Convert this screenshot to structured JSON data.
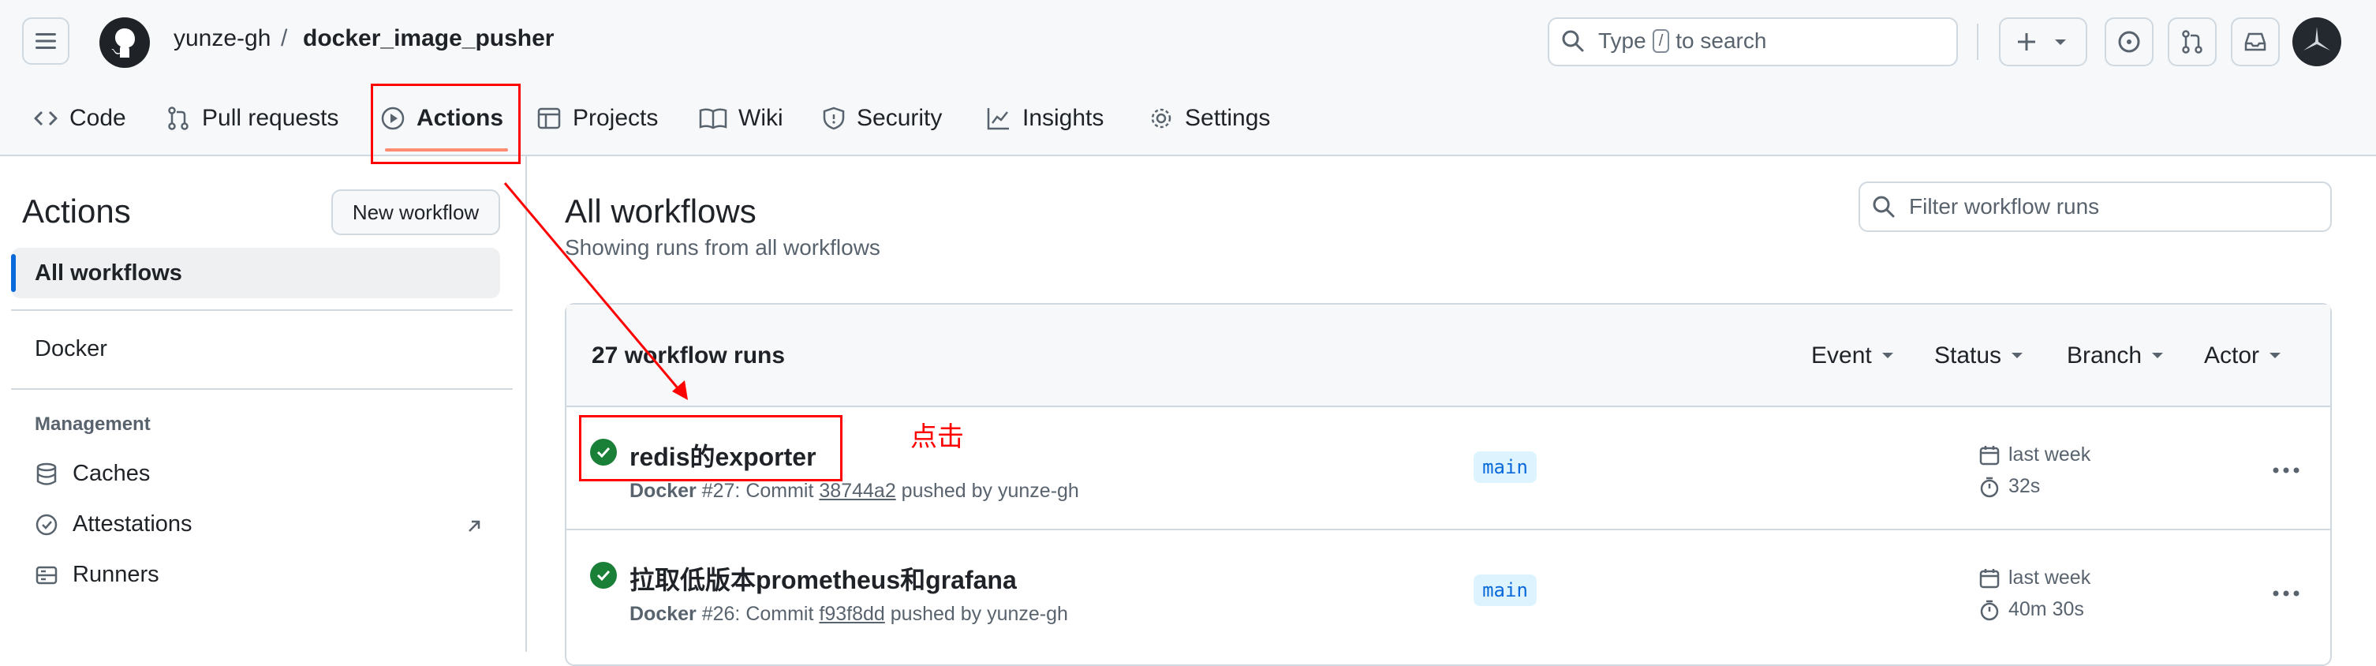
{
  "header": {
    "owner": "yunze-gh",
    "separator": "/",
    "repo": "docker_image_pusher",
    "search_label_pre": "Type",
    "search_key": "/",
    "search_label_post": "to search"
  },
  "tabs": [
    {
      "label": "Code"
    },
    {
      "label": "Pull requests"
    },
    {
      "label": "Actions"
    },
    {
      "label": "Projects"
    },
    {
      "label": "Wiki"
    },
    {
      "label": "Security"
    },
    {
      "label": "Insights"
    },
    {
      "label": "Settings"
    }
  ],
  "sidebar": {
    "title": "Actions",
    "new_workflow": "New workflow",
    "all_workflows": "All workflows",
    "docker": "Docker",
    "management_heading": "Management",
    "caches": "Caches",
    "attestations": "Attestations",
    "runners": "Runners"
  },
  "main": {
    "title": "All workflows",
    "subtitle": "Showing runs from all workflows",
    "filter_placeholder": "Filter workflow runs",
    "runs_count": "27 workflow runs",
    "filters": [
      "Event",
      "Status",
      "Branch",
      "Actor"
    ],
    "runs": [
      {
        "title": "redis的exporter",
        "workflow": "Docker",
        "number": "#27: Commit",
        "commit": "38744a2",
        "pushed_by": "pushed by yunze-gh",
        "branch": "main",
        "when": "last week",
        "duration": "32s",
        "status": "success"
      },
      {
        "title": "拉取低版本prometheus和grafana",
        "workflow": "Docker",
        "number": "#26: Commit",
        "commit": "f93f8dd",
        "pushed_by": "pushed by yunze-gh",
        "branch": "main",
        "when": "last week",
        "duration": "40m 30s",
        "status": "success"
      }
    ]
  },
  "annotation": {
    "click_label": "点击",
    "color": "#ff0000"
  },
  "colors": {
    "accent": "#0969da",
    "success": "#1a7f37",
    "tab_underline": "#fd8c73"
  }
}
